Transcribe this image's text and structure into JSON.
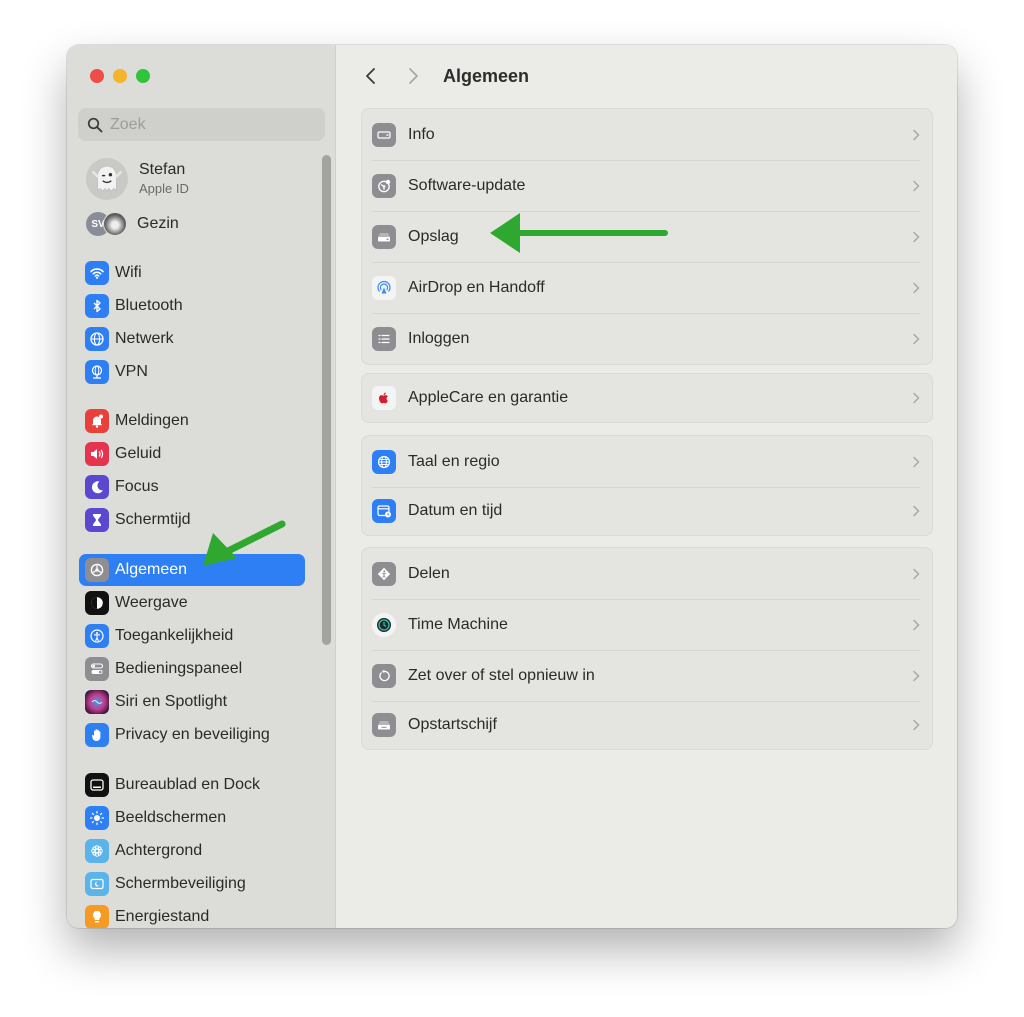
{
  "window": {
    "title": "Algemeen",
    "traffic_lights": [
      "close",
      "minimize",
      "maximize"
    ]
  },
  "sidebar": {
    "search": {
      "placeholder": "Zoek",
      "value": ""
    },
    "profile": {
      "name": "Stefan",
      "subtitle": "Apple ID",
      "avatar_icon": "ghost-avatar"
    },
    "family": {
      "label": "Gezin",
      "initials": "SV"
    },
    "selected": "Algemeen",
    "items": [
      {
        "label": "Wifi",
        "icon": "wifi-icon",
        "color": "#2f7ff4"
      },
      {
        "label": "Bluetooth",
        "icon": "bluetooth-icon",
        "color": "#2f7ff4"
      },
      {
        "label": "Netwerk",
        "icon": "globe-icon",
        "color": "#2f7ff4"
      },
      {
        "label": "VPN",
        "icon": "vpn-icon",
        "color": "#2f7ff4"
      },
      {
        "label": "Meldingen",
        "icon": "bell-icon",
        "color": "#e8403a"
      },
      {
        "label": "Geluid",
        "icon": "speaker-icon",
        "color": "#e53450"
      },
      {
        "label": "Focus",
        "icon": "moon-icon",
        "color": "#5a48d0"
      },
      {
        "label": "Schermtijd",
        "icon": "hourglass-icon",
        "color": "#5a48d0"
      },
      {
        "label": "Algemeen",
        "icon": "gear-icon",
        "color": "#8e8e92"
      },
      {
        "label": "Weergave",
        "icon": "appearance-icon",
        "color": "#111111"
      },
      {
        "label": "Toegankelijkheid",
        "icon": "accessibility-icon",
        "color": "#2f7ff4"
      },
      {
        "label": "Bedieningspaneel",
        "icon": "control-center-icon",
        "color": "#8e8e92"
      },
      {
        "label": "Siri en Spotlight",
        "icon": "siri-icon",
        "color": "#3a1d4a"
      },
      {
        "label": "Privacy en beveiliging",
        "icon": "hand-icon",
        "color": "#2f7ff4"
      },
      {
        "label": "Bureaublad en Dock",
        "icon": "dock-icon",
        "color": "#111111"
      },
      {
        "label": "Beeldschermen",
        "icon": "sun-icon",
        "color": "#2f7ff4"
      },
      {
        "label": "Achtergrond",
        "icon": "wallpaper-icon",
        "color": "#5ab4ea"
      },
      {
        "label": "Schermbeveiliging",
        "icon": "screensaver-icon",
        "color": "#5ab4ea"
      },
      {
        "label": "Energiestand",
        "icon": "lightbulb-icon",
        "color": "#f59a23"
      }
    ]
  },
  "main": {
    "nav": {
      "back": "back",
      "forward": "forward",
      "title": "Algemeen"
    },
    "groups": [
      {
        "rows": [
          {
            "label": "Info",
            "icon": "info-device-icon",
            "color": "#8e8e92"
          },
          {
            "label": "Software-update",
            "icon": "software-update-icon",
            "color": "#8e8e92"
          },
          {
            "label": "Opslag",
            "icon": "storage-icon",
            "color": "#8e8e92"
          },
          {
            "label": "AirDrop en Handoff",
            "icon": "airdrop-icon",
            "color": "#f4f4f4"
          },
          {
            "label": "Inloggen",
            "icon": "login-items-icon",
            "color": "#8e8e92"
          }
        ]
      },
      {
        "rows": [
          {
            "label": "AppleCare en garantie",
            "icon": "apple-icon",
            "color": "#f4f4f4"
          }
        ]
      },
      {
        "rows": [
          {
            "label": "Taal en regio",
            "icon": "globe-icon",
            "color": "#2f7ff4"
          },
          {
            "label": "Datum en tijd",
            "icon": "calendar-clock-icon",
            "color": "#2f7ff4"
          }
        ]
      },
      {
        "rows": [
          {
            "label": "Delen",
            "icon": "sharing-icon",
            "color": "#8e8e92"
          },
          {
            "label": "Time Machine",
            "icon": "time-machine-icon",
            "color": "#f4f4f4"
          },
          {
            "label": "Zet over of stel opnieuw in",
            "icon": "reset-icon",
            "color": "#8e8e92"
          },
          {
            "label": "Opstartschijf",
            "icon": "startup-disk-icon",
            "color": "#8e8e92"
          }
        ]
      }
    ]
  },
  "annotations": {
    "arrow_color": "#2ea82e",
    "arrows": [
      "points-to-sidebar-algemeen",
      "points-to-opslag"
    ]
  }
}
